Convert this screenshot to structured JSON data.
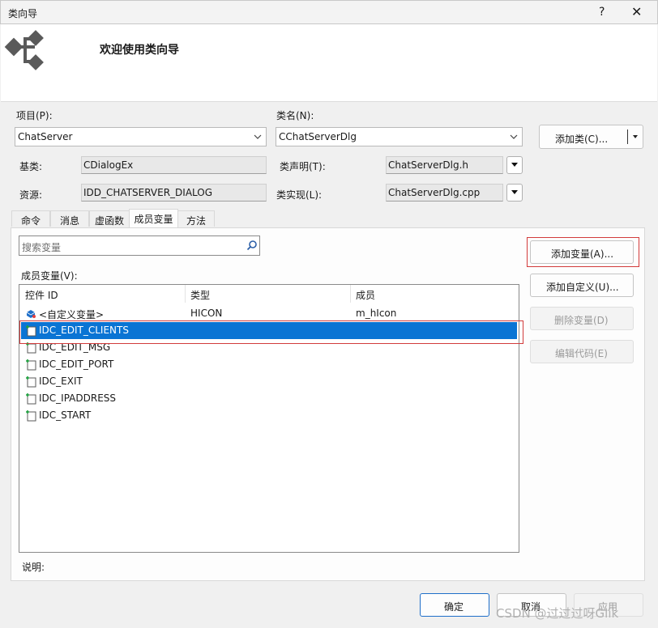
{
  "window": {
    "title": "类向导",
    "help": "?",
    "close": "✕"
  },
  "banner": {
    "welcome": "欢迎使用类向导"
  },
  "project": {
    "label": "项目(P):",
    "value": "ChatServer"
  },
  "classname": {
    "label": "类名(N):",
    "value": "CChatServerDlg"
  },
  "add_class_button": "添加类(C)...",
  "base": {
    "label": "基类:",
    "value": "CDialogEx"
  },
  "declaration": {
    "label": "类声明(T):",
    "value": "ChatServerDlg.h"
  },
  "resource": {
    "label": "资源:",
    "value": "IDD_CHATSERVER_DIALOG"
  },
  "implementation": {
    "label": "类实现(L):",
    "value": "ChatServerDlg.cpp"
  },
  "tabs": [
    {
      "label": "命令"
    },
    {
      "label": "消息"
    },
    {
      "label": "虚函数"
    },
    {
      "label": "成员变量"
    },
    {
      "label": "方法"
    }
  ],
  "active_tab": "成员变量",
  "search": {
    "placeholder": "搜索变量"
  },
  "members_label": "成员变量(V):",
  "columns": [
    "控件 ID",
    "类型",
    "成员"
  ],
  "rows": [
    {
      "id": "<自定义变量>",
      "type": "HICON",
      "member": "m_hIcon",
      "icon": "custom-variable-icon"
    },
    {
      "id": "IDC_EDIT_CLIENTS",
      "type": "",
      "member": "",
      "icon": "control-icon"
    },
    {
      "id": "IDC_EDIT_MSG",
      "type": "",
      "member": "",
      "icon": "control-icon"
    },
    {
      "id": "IDC_EDIT_PORT",
      "type": "",
      "member": "",
      "icon": "control-icon"
    },
    {
      "id": "IDC_EXIT",
      "type": "",
      "member": "",
      "icon": "control-icon"
    },
    {
      "id": "IDC_IPADDRESS",
      "type": "",
      "member": "",
      "icon": "control-icon"
    },
    {
      "id": "IDC_START",
      "type": "",
      "member": "",
      "icon": "control-icon"
    }
  ],
  "selected_row": "IDC_EDIT_CLIENTS",
  "side_buttons": {
    "add_variable": "添加变量(A)...",
    "add_custom": "添加自定义(U)...",
    "delete_variable": "删除变量(D)",
    "edit_code": "编辑代码(E)"
  },
  "description_label": "说明:",
  "footer": {
    "ok": "确定",
    "cancel": "取消",
    "apply": "应用"
  },
  "watermark": "CSDN @过过过呀Glik",
  "colors": {
    "selection": "#0a74d4",
    "highlight_box": "#d23b3b",
    "logo": "#5a5a5a"
  }
}
